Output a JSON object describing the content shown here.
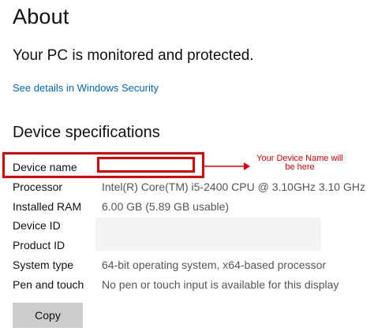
{
  "page": {
    "title": "About",
    "protection_status": "Your PC is monitored and protected.",
    "security_link": "See details in Windows Security"
  },
  "device_specs": {
    "heading": "Device specifications",
    "rows": [
      {
        "label": "Device name",
        "value": ""
      },
      {
        "label": "Processor",
        "value": "Intel(R) Core(TM) i5-2400 CPU @ 3.10GHz   3.10 GHz"
      },
      {
        "label": "Installed RAM",
        "value": "6.00 GB (5.89 GB usable)"
      },
      {
        "label": "Device ID",
        "value": ""
      },
      {
        "label": "Product ID",
        "value": ""
      },
      {
        "label": "System type",
        "value": "64-bit operating system, x64-based processor"
      },
      {
        "label": "Pen and touch",
        "value": "No pen or touch input is available for this display"
      }
    ]
  },
  "annotation": {
    "text_line1": "Your Device Name will",
    "text_line2": "be here",
    "color": "#e00000"
  },
  "actions": {
    "copy_label": "Copy"
  },
  "colors": {
    "link": "#0067c0",
    "button_bg": "#cccccc",
    "value_text": "#555555"
  }
}
